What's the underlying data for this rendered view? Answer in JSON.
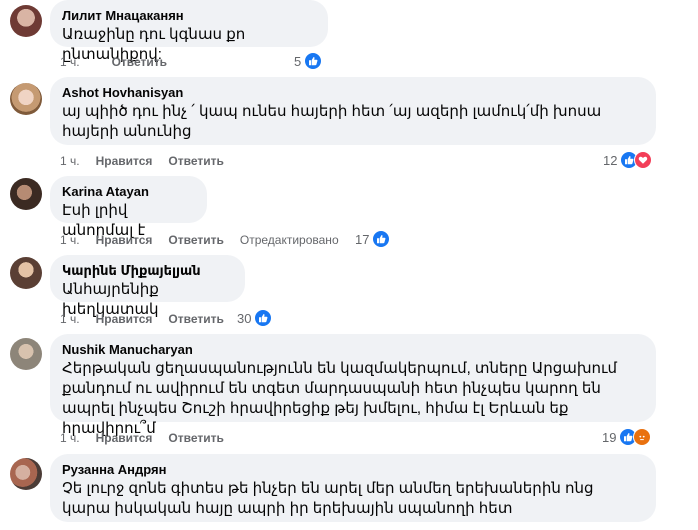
{
  "colors": {
    "bubble_bg": "#f0f2f5",
    "action_text": "#65676b",
    "like_blue": "#1877f2",
    "love_red": "#f33e58",
    "angry_orange": "#e9710f"
  },
  "labels": {
    "like": "Нравится",
    "reply": "Ответить",
    "edited": "Отредактировано"
  },
  "comments": [
    {
      "author": "Лилит Мнацаканян",
      "text": "Առաջինը դու կգնաս քո ընտանիքով:",
      "time": "1 ч.",
      "reply_label": "Ответить",
      "reaction_count": "5",
      "reactions": [
        "like-icon"
      ]
    },
    {
      "author": "Ashot Hovhanisyan",
      "text": "այ պիիծ դու ինչ ՛ կապ ունես հայերի հետ ՛այ ազերի լամուկ՛մի խոսա հայերի անունից",
      "time": "1 ч.",
      "like_label": "Нравится",
      "reply_label": "Ответить",
      "reaction_count": "12",
      "reactions": [
        "like-icon",
        "love-icon"
      ]
    },
    {
      "author": "Karina Atayan",
      "text": "Էսի լրիվ անորմալ է",
      "time": "1 ч.",
      "like_label": "Нравится",
      "reply_label": "Ответить",
      "edited_label": "Отредактировано",
      "reaction_count": "17",
      "reactions": [
        "like-icon"
      ]
    },
    {
      "author": "Կարինե Միքայելյան",
      "text": "Անհայրենիք խեղկատակ",
      "time": "1 ч.",
      "like_label": "Нравится",
      "reply_label": "Ответить",
      "reaction_count": "30",
      "reactions": [
        "like-icon"
      ]
    },
    {
      "author": "Nushik Manucharyan",
      "text": "Հերթական ցեղասպանությունն են կազմակերպում, տները Արցախում քանդում ու ավիրում են տգետ մարդասպանի հետ ինչպես կարող են ապրել ինչպես Շուշի հրավիրեցիք թեյ խմելու, հիմա էլ Երևան եք հրավիրու՞մ",
      "time": "1 ч.",
      "like_label": "Нравится",
      "reply_label": "Ответить",
      "reaction_count": "19",
      "reactions": [
        "like-icon",
        "angry-icon"
      ]
    },
    {
      "author": "Рузанна Андрян",
      "text": "Չե լուրջ զոնե գիտես թե ինչեր են արել մեր անմեղ երեխաներին ոնց կարա իսկական հայը ապրի իր երեխային սպանողի հետ"
    }
  ]
}
